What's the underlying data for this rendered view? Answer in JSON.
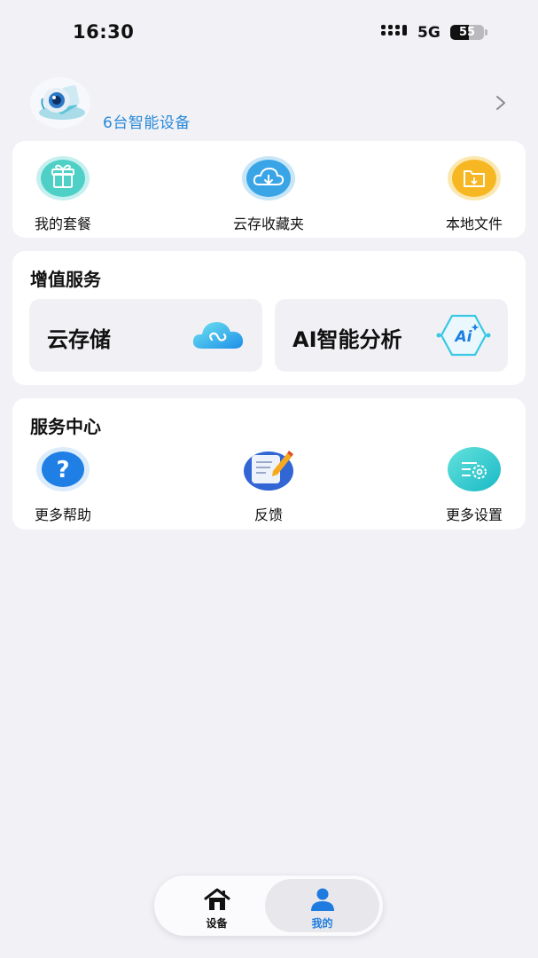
{
  "status_bar": {
    "time": "16:30",
    "network": "5G",
    "battery": "55"
  },
  "profile": {
    "subtitle": "6台智能设备"
  },
  "quick_actions": [
    {
      "label": "我的套餐",
      "icon": "gift-icon"
    },
    {
      "label": "云存收藏夹",
      "icon": "cloud-download-icon"
    },
    {
      "label": "本地文件",
      "icon": "folder-icon"
    }
  ],
  "value_added": {
    "title": "增值服务",
    "items": [
      {
        "label": "云存储",
        "icon": "cloud-storage-icon"
      },
      {
        "label": "AI智能分析",
        "icon": "ai-chip-icon"
      }
    ]
  },
  "service_center": {
    "title": "服务中心",
    "items": [
      {
        "label": "更多帮助",
        "icon": "help-icon"
      },
      {
        "label": "反馈",
        "icon": "feedback-icon"
      },
      {
        "label": "更多设置",
        "icon": "settings-icon"
      }
    ]
  },
  "tabs": [
    {
      "label": "设备",
      "icon": "home-icon",
      "active": false
    },
    {
      "label": "我的",
      "icon": "person-icon",
      "active": true
    }
  ],
  "colors": {
    "background": "#f1f1f6",
    "accent_blue": "#2a8ad8",
    "tab_active": "#1f7be0"
  }
}
